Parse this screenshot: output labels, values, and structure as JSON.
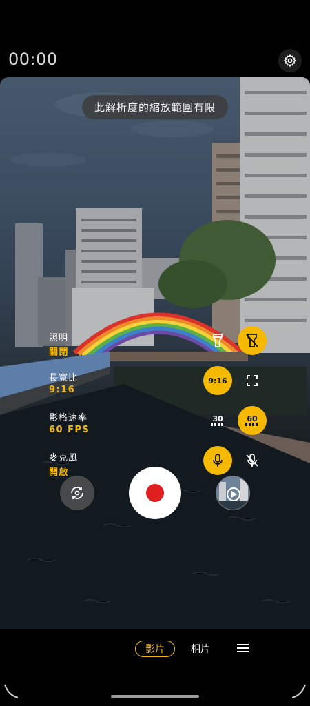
{
  "header": {
    "timer": "00:00",
    "settings_icon": "gear-icon"
  },
  "viewfinder": {
    "toast": "此解析度的縮放範圍有限"
  },
  "settings": [
    {
      "label": "照明",
      "value": "關閉"
    },
    {
      "label": "長寬比",
      "value": "9:16"
    },
    {
      "label": "影格速率",
      "value": "60 FPS"
    },
    {
      "label": "麥克風",
      "value": "開啟"
    }
  ],
  "options": {
    "lighting": {
      "on_icon": "flashlight-icon",
      "off_icon": "flashlight-off-icon",
      "selected": "off"
    },
    "aspect": {
      "ratio_label": "9:16",
      "full_icon": "fullscreen-icon",
      "selected": "9:16"
    },
    "fps": {
      "low": "30",
      "high": "60",
      "selected": "60"
    },
    "mic": {
      "on_icon": "microphone-icon",
      "off_icon": "microphone-off-icon",
      "selected": "on"
    }
  },
  "controls": {
    "expand_icon": "chevron-down-icon",
    "flip_icon": "camera-switch-icon",
    "record_icon": "record-icon",
    "gallery_icon": "gallery-thumbnail"
  },
  "modes": {
    "video": "影片",
    "photo": "相片",
    "menu_icon": "hamburger-menu-icon",
    "active": "video"
  },
  "colors": {
    "accent": "#f5b900",
    "record": "#e02020"
  }
}
